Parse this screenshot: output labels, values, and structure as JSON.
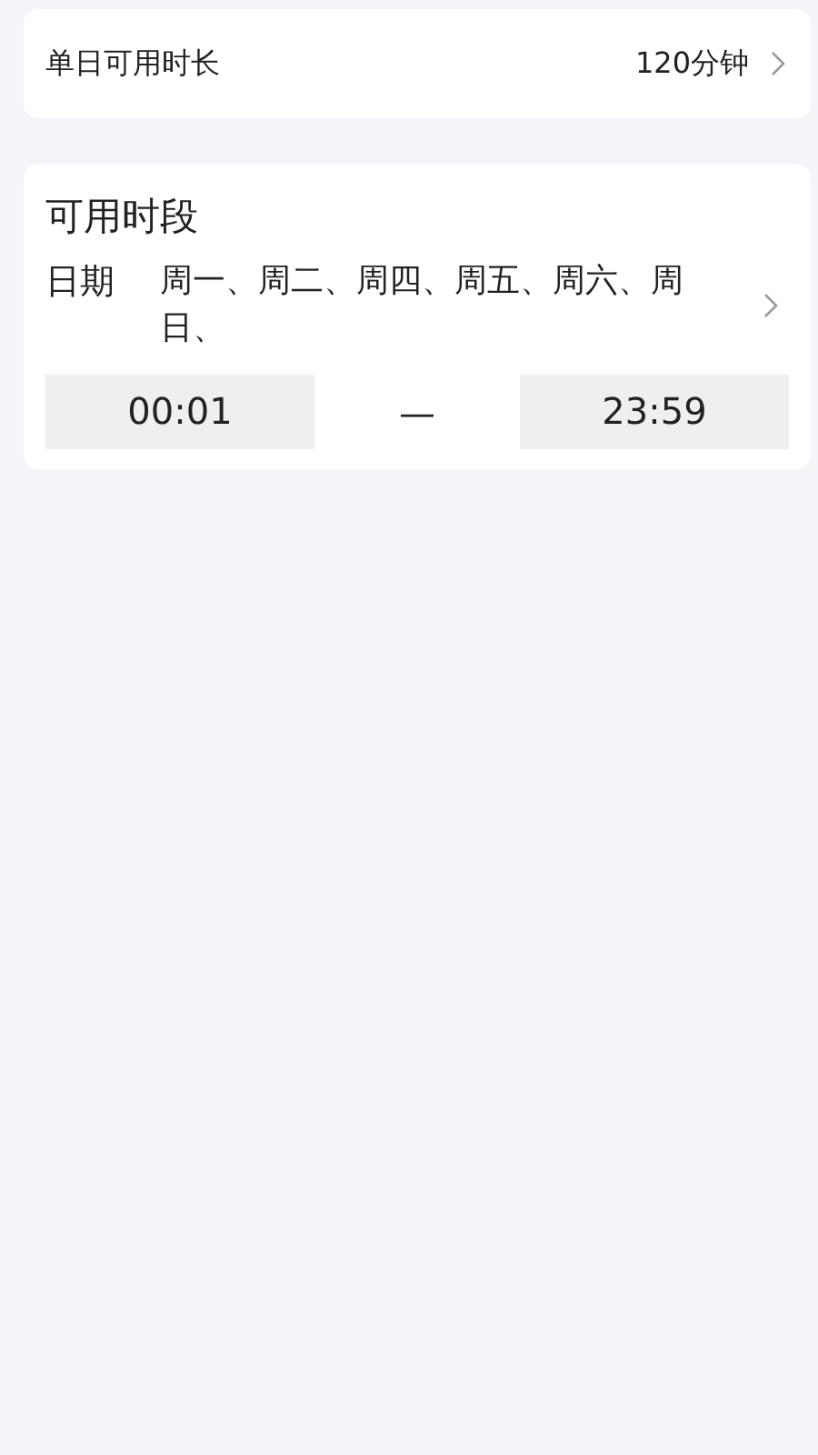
{
  "daily_limit": {
    "label": "单日可用时长",
    "value": "120分钟"
  },
  "available_period": {
    "title": "可用时段",
    "date_label": "日期",
    "days": "周一、周二、周四、周五、周六、周日、",
    "start_time": "00:01",
    "separator": "—",
    "end_time": "23:59"
  }
}
